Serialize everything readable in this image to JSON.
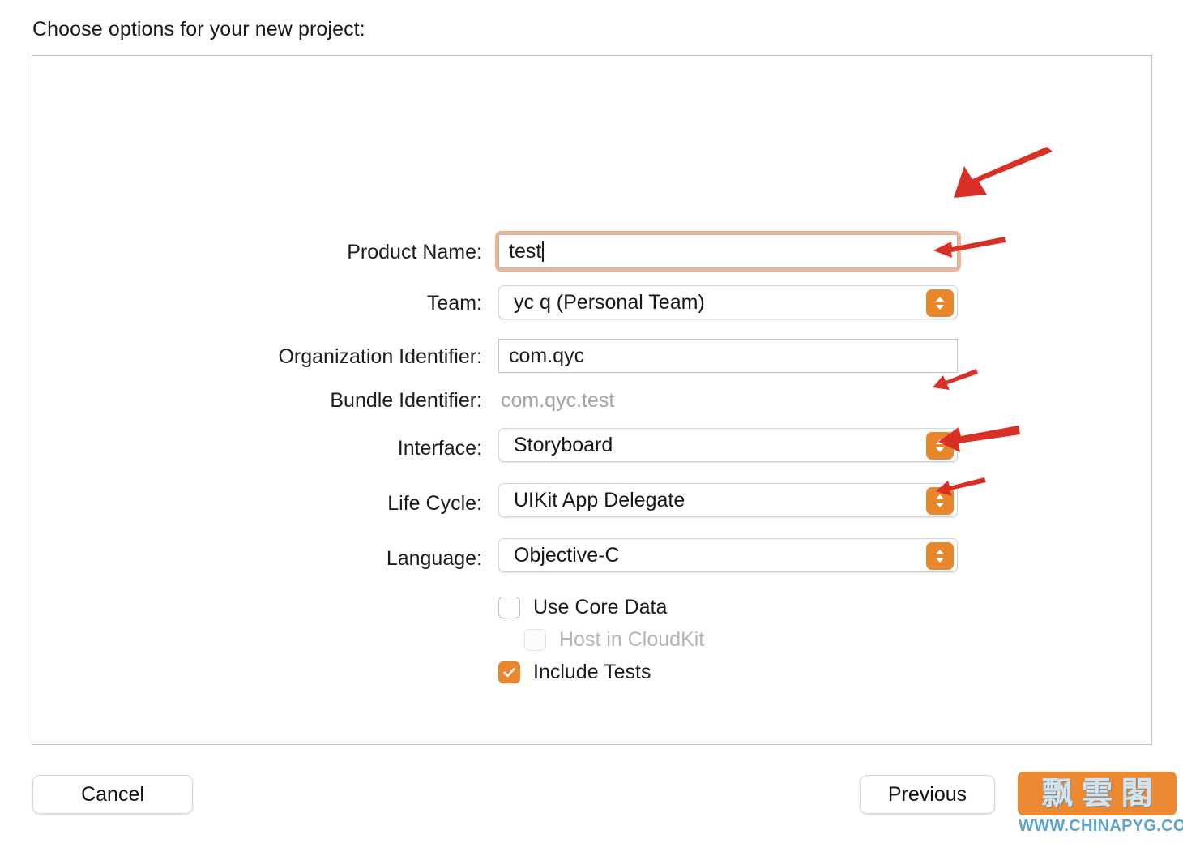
{
  "dialog": {
    "title": "Choose options for your new project:"
  },
  "fields": [
    {
      "label": "Product Name:",
      "type": "text",
      "value": "test",
      "focused": true,
      "name": "product-name"
    },
    {
      "label": "Team:",
      "type": "popup",
      "value": "yc q (Personal Team)",
      "name": "team"
    },
    {
      "label": "Organization Identifier:",
      "type": "text",
      "value": "com.qyc",
      "focused": false,
      "name": "organization-identifier"
    },
    {
      "label": "Bundle Identifier:",
      "type": "static",
      "value": "com.qyc.test",
      "name": "bundle-identifier"
    },
    {
      "label": "Interface:",
      "type": "popup",
      "value": "Storyboard",
      "name": "interface"
    },
    {
      "label": "Life Cycle:",
      "type": "popup",
      "value": "UIKit App Delegate",
      "name": "life-cycle"
    },
    {
      "label": "Language:",
      "type": "popup",
      "value": "Objective-C",
      "name": "language"
    }
  ],
  "checkboxes": [
    {
      "label": "Use Core Data",
      "checked": false,
      "disabled": false,
      "name": "use-core-data"
    },
    {
      "label": "Host in CloudKit",
      "checked": false,
      "disabled": true,
      "name": "host-in-cloudkit"
    },
    {
      "label": "Include Tests",
      "checked": true,
      "disabled": false,
      "name": "include-tests"
    }
  ],
  "buttons": {
    "cancel": "Cancel",
    "previous": "Previous"
  },
  "watermark": {
    "cjk_1": "飘",
    "cjk_2": "雲",
    "cjk_3": "閣",
    "url": "WWW.CHINAPYG.COM"
  },
  "colors": {
    "accent_orange": "#e8872e",
    "focus_ring": "#f0b494",
    "annotation_red": "#d93025",
    "watermark_orange": "#ec8a33",
    "watermark_blue": "#5aa4cf",
    "panel_border": "#c3c3c5"
  },
  "annotations": {
    "arrow_count": 5,
    "targets": [
      "product-name",
      "team",
      "interface",
      "life-cycle",
      "language"
    ]
  }
}
